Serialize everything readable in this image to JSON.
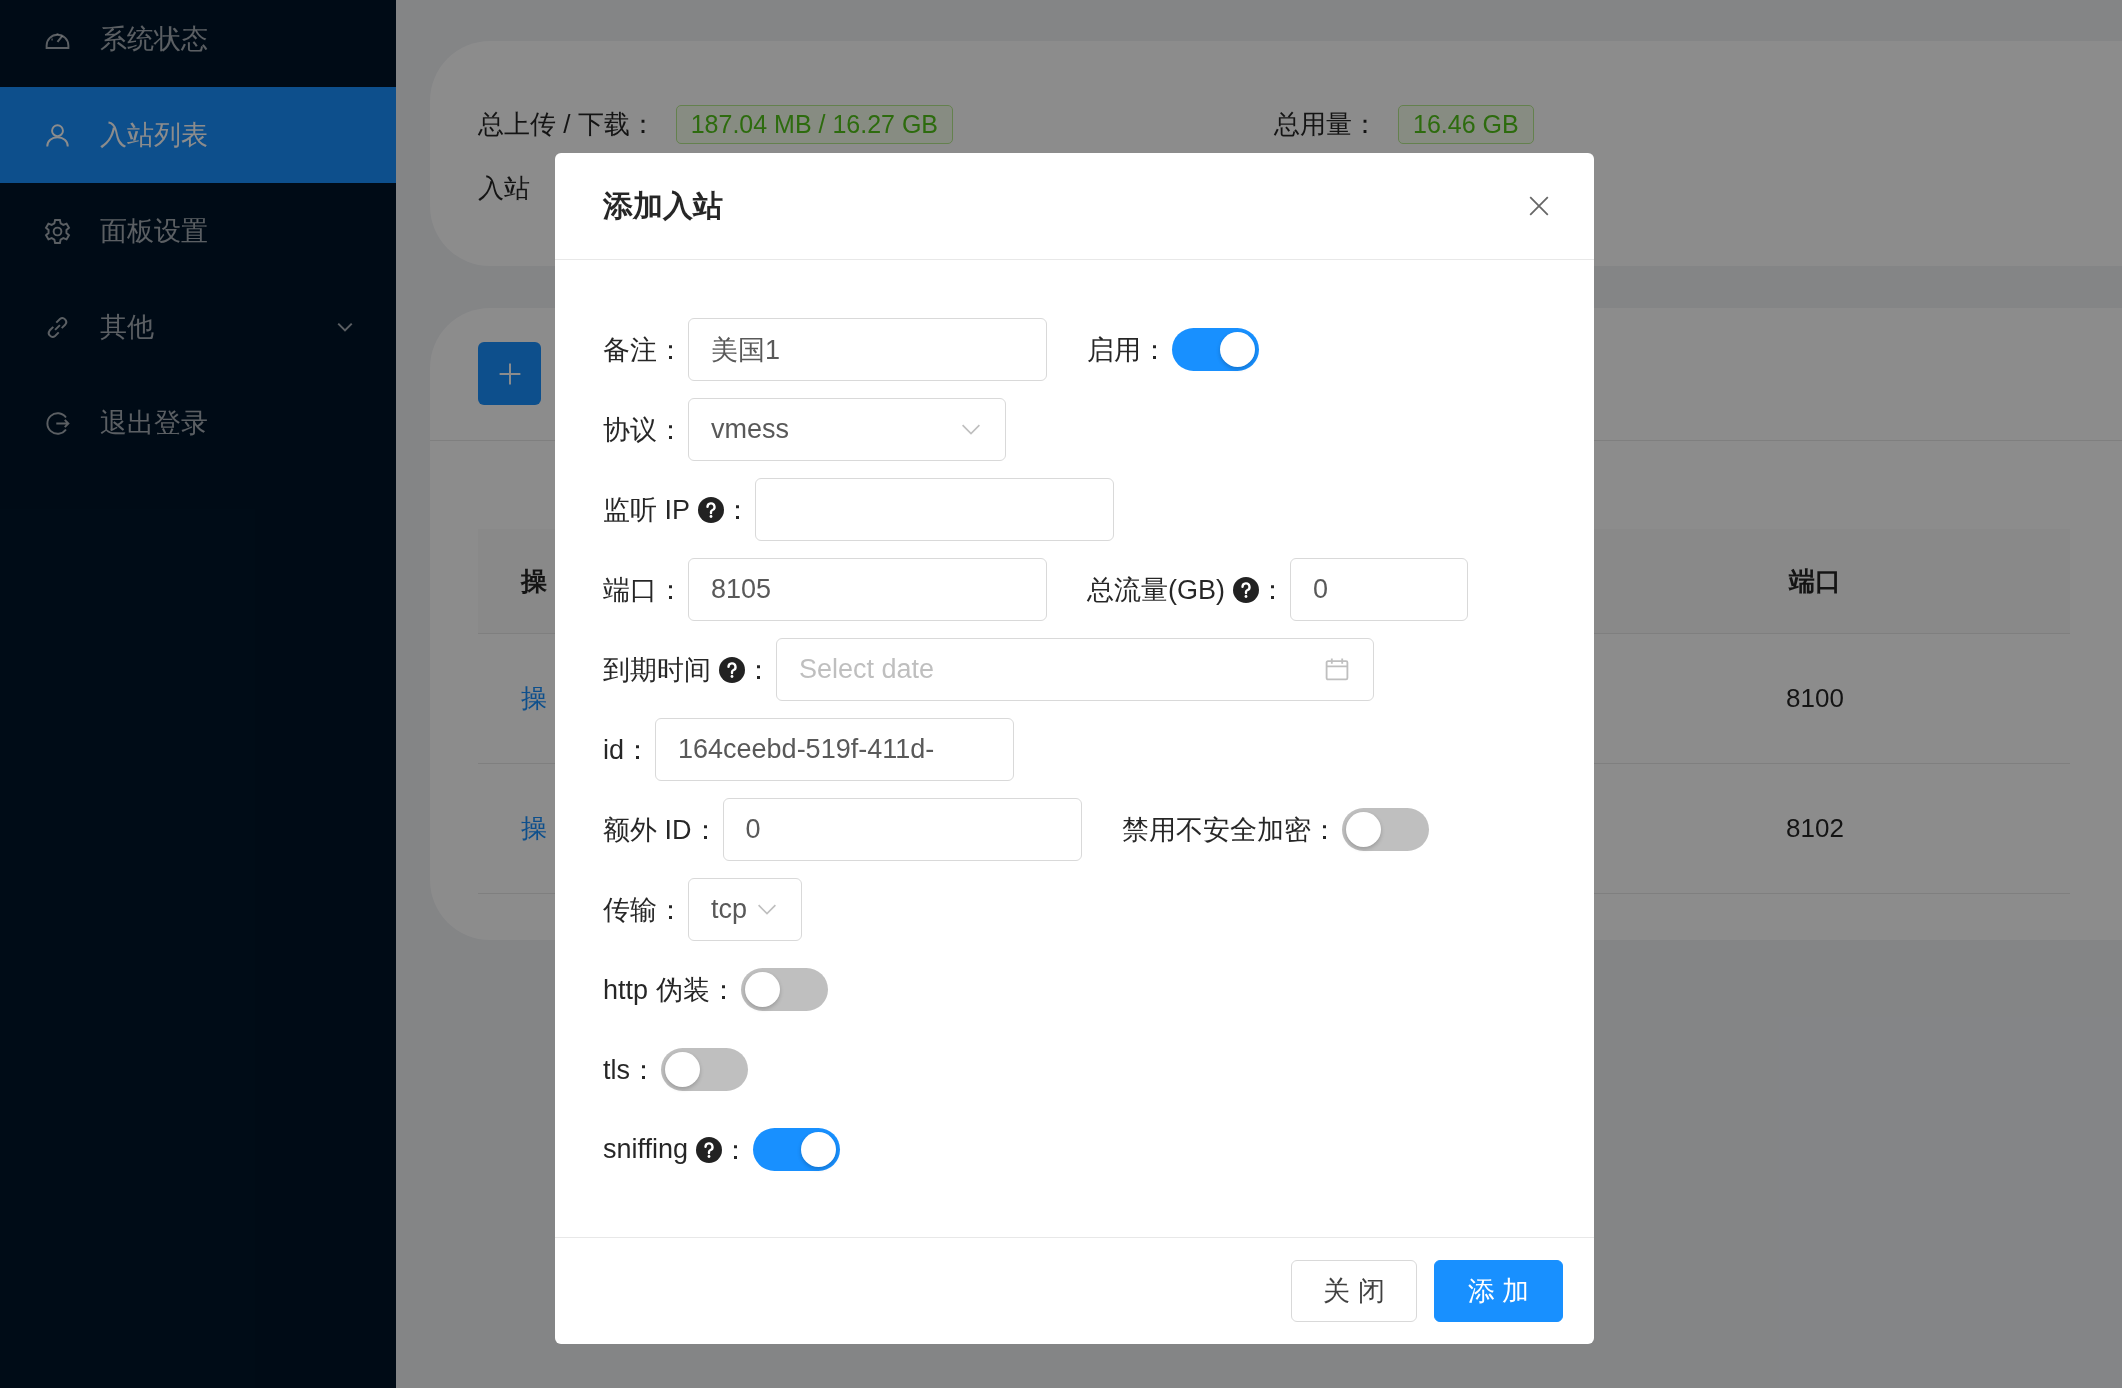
{
  "sidebar": {
    "items": [
      {
        "label": "系统状态",
        "selected": false,
        "has_submenu": false
      },
      {
        "label": "入站列表",
        "selected": true,
        "has_submenu": false
      },
      {
        "label": "面板设置",
        "selected": false,
        "has_submenu": false
      },
      {
        "label": "其他",
        "selected": false,
        "has_submenu": true
      },
      {
        "label": "退出登录",
        "selected": false,
        "has_submenu": false
      }
    ]
  },
  "stats": [
    {
      "label": "总上传 / 下载：",
      "value": "187.04 MB / 16.27 GB"
    },
    {
      "label": "总用量：",
      "value": "16.46 GB"
    },
    {
      "label": "入站"
    }
  ],
  "table": {
    "columns": [
      "操",
      "端口"
    ],
    "rows": [
      [
        "操",
        "8100"
      ],
      [
        "操",
        "8102"
      ]
    ]
  },
  "modal": {
    "title": "添加入站",
    "rows": [
      {
        "items": [
          {
            "kind": "input",
            "label": "备注",
            "colon": "：",
            "help": false,
            "value": "美国1"
          },
          {
            "kind": "switch",
            "label": "启用",
            "colon": "：",
            "help": false,
            "on": true
          }
        ]
      },
      {
        "items": [
          {
            "kind": "select",
            "label": "协议",
            "colon": "：",
            "help": false,
            "value": "vmess"
          }
        ]
      },
      {
        "items": [
          {
            "kind": "input",
            "label": "监听 IP",
            "colon": "：",
            "help": true
          }
        ]
      },
      {
        "items": [
          {
            "kind": "input",
            "label": "端口",
            "colon": "：",
            "help": false,
            "value": "8105"
          },
          {
            "kind": "input",
            "label": "总流量(GB)",
            "colon": "：",
            "help": true,
            "value": "0"
          }
        ]
      },
      {
        "items": [
          {
            "kind": "date",
            "label": "到期时间",
            "colon": "：",
            "help": true,
            "placeholder": "Select date"
          }
        ]
      },
      {
        "items": [
          {
            "kind": "input",
            "label": "id",
            "colon": "：",
            "help": false,
            "value": "164ceebd-519f-411d-"
          }
        ]
      },
      {
        "items": [
          {
            "kind": "input",
            "label": "额外 ID",
            "colon": "：",
            "help": false,
            "value": "0"
          },
          {
            "kind": "switch",
            "label": "禁用不安全加密",
            "colon": "：",
            "help": false,
            "on": false
          }
        ]
      },
      {
        "items": [
          {
            "kind": "select",
            "label": "传输",
            "colon": "：",
            "help": false,
            "value": "tcp"
          }
        ]
      },
      {
        "items": [
          {
            "kind": "switch",
            "label": "http 伪装",
            "colon": "：",
            "help": false,
            "on": false
          }
        ]
      },
      {
        "items": [
          {
            "kind": "switch",
            "label": "tls",
            "colon": "：",
            "help": false,
            "on": false
          }
        ]
      },
      {
        "items": [
          {
            "kind": "switch",
            "label": "sniffing",
            "colon": "：",
            "help": true,
            "on": true
          }
        ]
      }
    ],
    "buttons": [
      {
        "label": "关 闭",
        "primary": false
      },
      {
        "label": "添 加",
        "primary": true
      }
    ]
  }
}
